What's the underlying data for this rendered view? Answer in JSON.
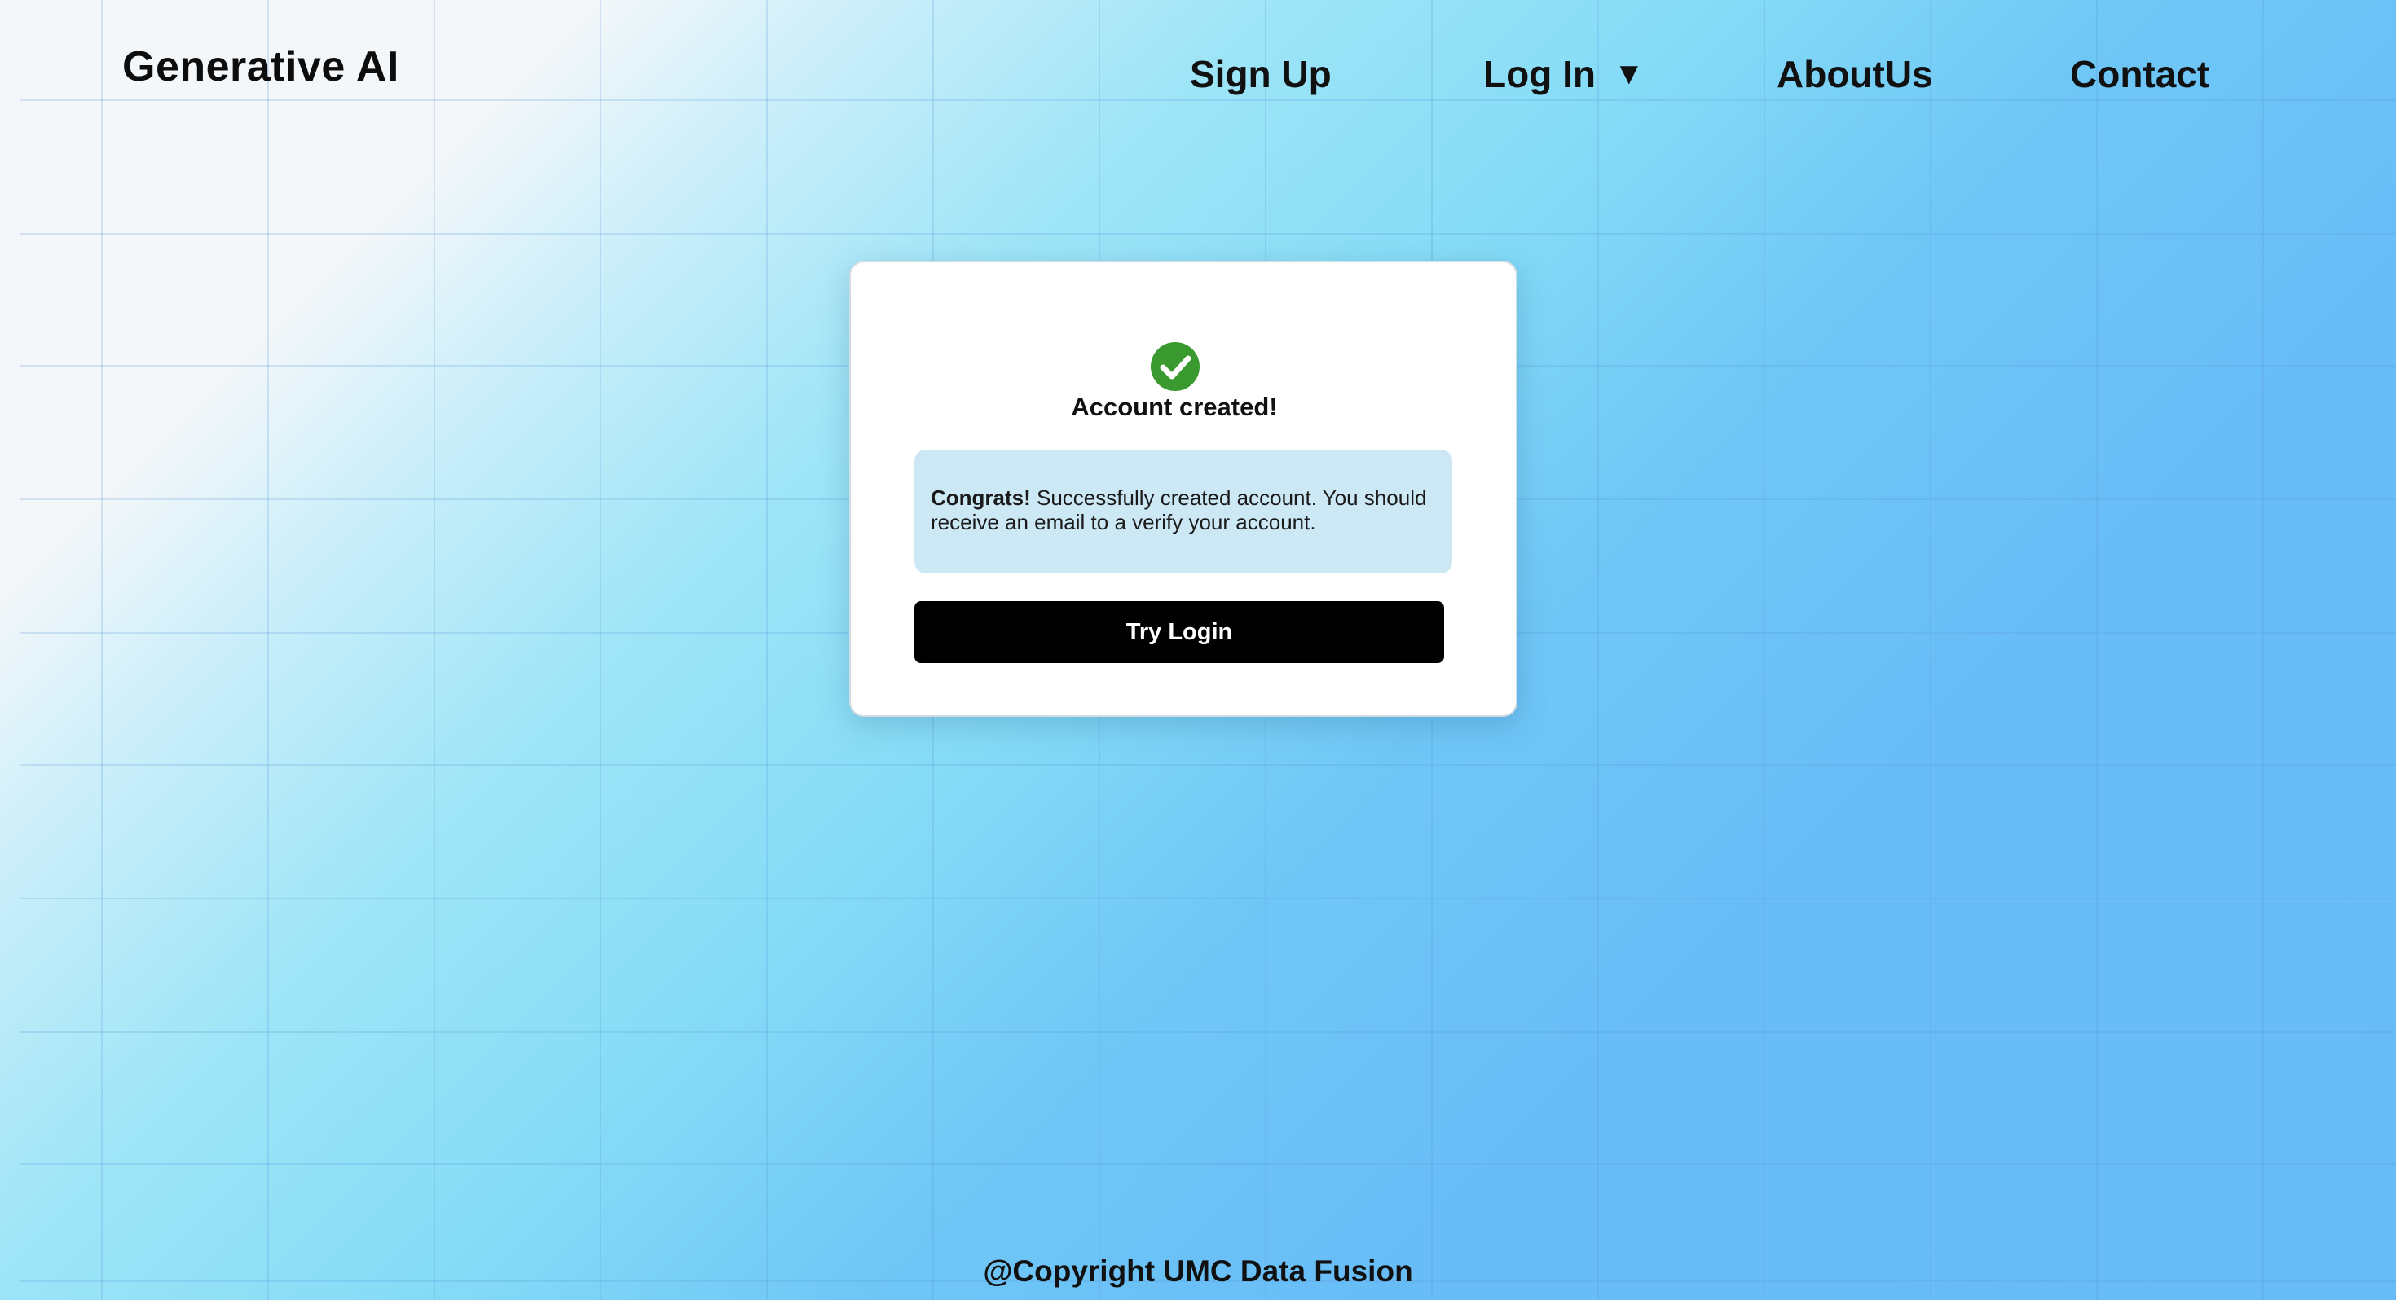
{
  "header": {
    "brand": "Generative AI",
    "nav": {
      "sign_up": "Sign Up",
      "log_in": "Log In",
      "log_in_caret": "▼",
      "about_us": "AboutUs",
      "contact": "Contact"
    }
  },
  "card": {
    "icon": "check-circle-icon",
    "title": "Account created!",
    "alert": {
      "strong": "Congrats!",
      "message": " Successfully created account. You should receive an email to a verify your account."
    },
    "button_label": "Try Login"
  },
  "footer": {
    "text": "@Copyright UMC Data Fusion"
  },
  "colors": {
    "success_green": "#3a9a2f",
    "alert_bg": "#cce8f4",
    "button_bg": "#000000"
  }
}
